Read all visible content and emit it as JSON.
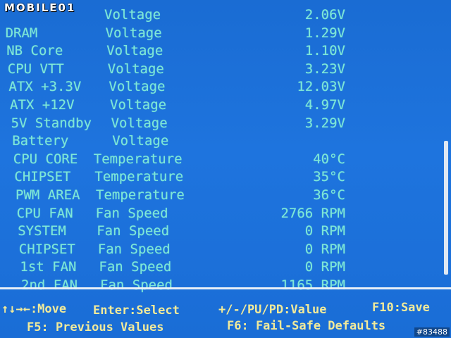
{
  "watermark_logo": "MOBILE01",
  "monitor_rows": [
    {
      "label": "",
      "kind": "Voltage",
      "value": "2.06V"
    },
    {
      "label": "DRAM",
      "kind": "Voltage",
      "value": "1.29V"
    },
    {
      "label": "NB Core",
      "kind": "Voltage",
      "value": "1.10V"
    },
    {
      "label": "CPU VTT",
      "kind": "Voltage",
      "value": "3.23V"
    },
    {
      "label": "ATX +3.3V",
      "kind": "Voltage",
      "value": "12.03V"
    },
    {
      "label": "ATX +12V",
      "kind": "Voltage",
      "value": "4.97V"
    },
    {
      "label": "5V Standby",
      "kind": "Voltage",
      "value": "3.29V"
    },
    {
      "label": "Battery",
      "kind": "Voltage",
      "value": ""
    },
    {
      "label": "CPU CORE",
      "kind": "Temperature",
      "value": "40°C"
    },
    {
      "label": "CHIPSET",
      "kind": "Temperature",
      "value": "35°C"
    },
    {
      "label": "PWM AREA",
      "kind": "Temperature",
      "value": "36°C"
    },
    {
      "label": "CPU FAN",
      "kind": "Fan Speed",
      "value": "2766 RPM"
    },
    {
      "label": "SYSTEM",
      "kind": "Fan Speed",
      "value": "0 RPM"
    },
    {
      "label": "CHIPSET",
      "kind": "Fan Speed",
      "value": "0 RPM"
    },
    {
      "label": "1st FAN",
      "kind": "Fan Speed",
      "value": "0 RPM"
    },
    {
      "label": "2nd FAN",
      "kind": "Fan Speed",
      "value": "1165 RPM"
    }
  ],
  "help": {
    "move": "↑↓→←:Move",
    "enter": "Enter:Select",
    "value": "+/-/PU/PD:Value",
    "save": "F10:Save",
    "previous": "F5: Previous Values",
    "failsafe": "F6: Fail-Safe Defaults"
  },
  "photo_id": "#83488"
}
